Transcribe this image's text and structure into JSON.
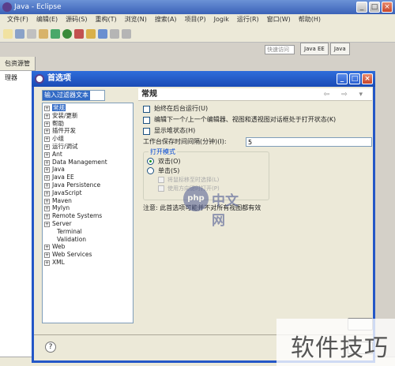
{
  "window": {
    "title": "Java - Eclipse"
  },
  "menubar": [
    "文件(F)",
    "编辑(E)",
    "源码(S)",
    "重构(T)",
    "浏览(N)",
    "搜索(A)",
    "项目(P)",
    "Jogik",
    "运行(R)",
    "窗口(W)",
    "帮助(H)"
  ],
  "quick_access": "快速访问",
  "perspectives": [
    "Java EE",
    "Java"
  ],
  "left_view": {
    "tab": "包资源管理器"
  },
  "dialog": {
    "title": "首选项",
    "filter_text": "输入过滤器文本",
    "tree": [
      {
        "label": "常规",
        "expander": "+",
        "selected": true
      },
      {
        "label": "安装/更新",
        "expander": "+"
      },
      {
        "label": "帮助",
        "expander": "+"
      },
      {
        "label": "插件开发",
        "expander": "+"
      },
      {
        "label": "小组",
        "expander": "+"
      },
      {
        "label": "运行/调试",
        "expander": "+"
      },
      {
        "label": "Ant",
        "expander": "+"
      },
      {
        "label": "Data Management",
        "expander": "+"
      },
      {
        "label": "Java",
        "expander": "+"
      },
      {
        "label": "Java EE",
        "expander": "+"
      },
      {
        "label": "Java Persistence",
        "expander": "+"
      },
      {
        "label": "JavaScript",
        "expander": "+"
      },
      {
        "label": "Maven",
        "expander": "+"
      },
      {
        "label": "Mylyn",
        "expander": "+"
      },
      {
        "label": "Remote Systems",
        "expander": "+"
      },
      {
        "label": "Server",
        "expander": "+"
      },
      {
        "label": "Terminal",
        "expander": ""
      },
      {
        "label": "Validation",
        "expander": ""
      },
      {
        "label": "Web",
        "expander": "+"
      },
      {
        "label": "Web Services",
        "expander": "+"
      },
      {
        "label": "XML",
        "expander": "+"
      }
    ],
    "page_title": "常规",
    "options": [
      "始终在后台运行(U)",
      "编辑下一个/上一个编辑器、视图和透视图对话框处于打开状态(K)",
      "显示堆状态(H)"
    ],
    "save_interval_label": "工作台保存时间间隔(分钟)(I):",
    "save_interval_value": "5",
    "open_mode": {
      "label": "打开模式",
      "double_click": "双击(O)",
      "single_click": "单击(S)",
      "sub1": "将鼠标移至时选择(L)",
      "sub2": "使用方向键时打开(P)"
    },
    "note": "注意: 此首选项可能并不对所有视图都有效"
  },
  "watermarks": {
    "php": "php",
    "php_site": "中文网",
    "corner": "软件技巧"
  }
}
